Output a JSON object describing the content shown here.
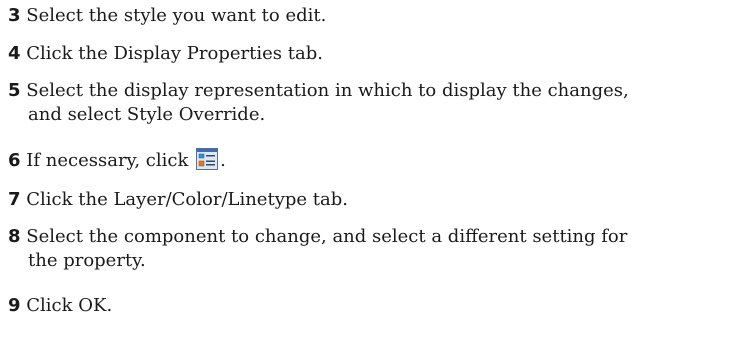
{
  "steps": [
    {
      "num": "3",
      "text": "Select the style you want to edit."
    },
    {
      "num": "4",
      "text": "Click the Display Properties tab."
    },
    {
      "num": "5",
      "text": "Select the display representation in which to display the changes,",
      "text2": "and select Style Override."
    },
    {
      "num": "6",
      "text": "If necessary, click",
      "after": ".",
      "icon": "style-properties-icon"
    },
    {
      "num": "7",
      "text": "Click the Layer/Color/Linetype tab."
    },
    {
      "num": "8",
      "text": "Select the component to change, and select a different setting for",
      "text2": "the property."
    },
    {
      "num": "9",
      "text": "Click OK."
    }
  ]
}
